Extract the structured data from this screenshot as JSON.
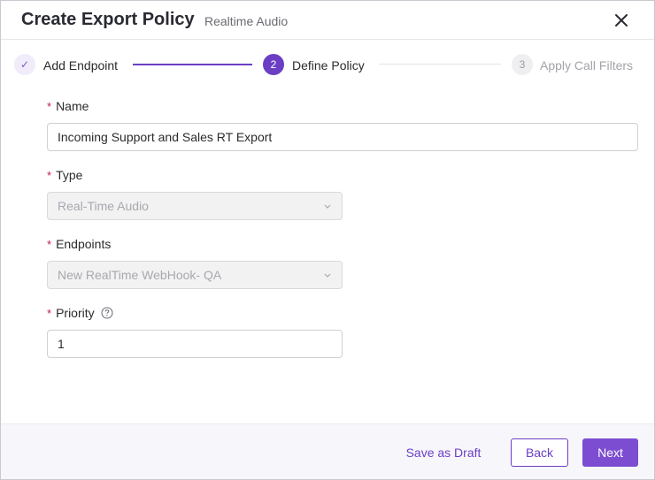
{
  "dialog": {
    "title": "Create Export Policy",
    "subtitle": "Realtime Audio",
    "close_icon": "close-icon"
  },
  "stepper": {
    "steps": [
      {
        "marker": "✓",
        "label": "Add Endpoint",
        "state": "done"
      },
      {
        "marker": "2",
        "label": "Define Policy",
        "state": "active"
      },
      {
        "marker": "3",
        "label": "Apply Call Filters",
        "state": "pending"
      }
    ]
  },
  "form": {
    "required_mark": "*",
    "name": {
      "label": "Name",
      "value": "Incoming Support and Sales RT Export"
    },
    "type": {
      "label": "Type",
      "value": "Real-Time Audio",
      "disabled": true
    },
    "endpoints": {
      "label": "Endpoints",
      "value": "New RealTime WebHook- QA",
      "disabled": true
    },
    "priority": {
      "label": "Priority",
      "value": "1",
      "help_icon": "help-circle-icon"
    }
  },
  "footer": {
    "save_draft_label": "Save as Draft",
    "back_label": "Back",
    "next_label": "Next"
  },
  "colors": {
    "accent": "#6b3fc4",
    "primary_button": "#7c4dd0",
    "required": "#c2185b"
  }
}
